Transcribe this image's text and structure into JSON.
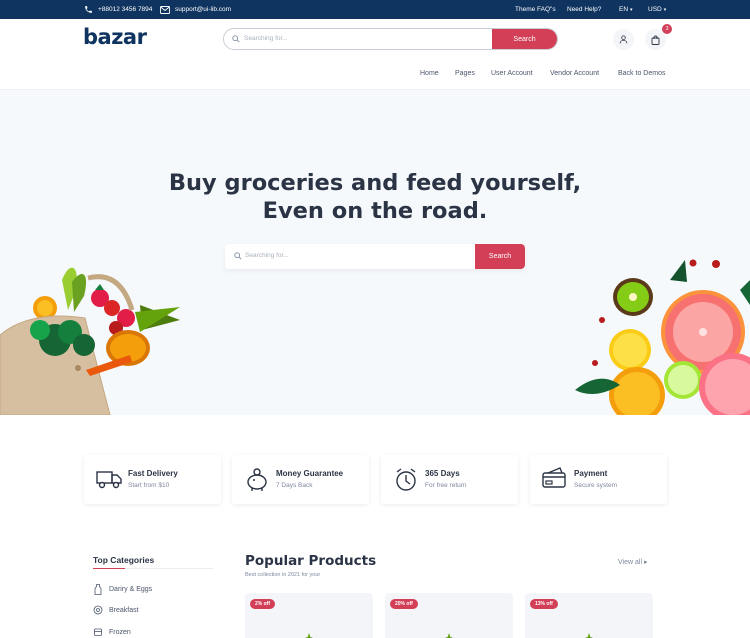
{
  "topbar": {
    "phone": "+88012 3456 7894",
    "email": "support@ui-lib.com",
    "faq": "Theme FAQ\"s",
    "help": "Need Help?",
    "language": "EN",
    "currency": "USD"
  },
  "header": {
    "logo": "bazar",
    "search_placeholder": "Searching for...",
    "search_button": "Search",
    "cart_count": "3",
    "nav": [
      "Home",
      "Pages",
      "User Account",
      "Vendor Account",
      "Back to Demos"
    ]
  },
  "hero": {
    "title_line1": "Buy groceries and feed yourself,",
    "title_line2": "Even on the road.",
    "search_placeholder": "Searching for...",
    "search_button": "Search"
  },
  "services": [
    {
      "title": "Fast Delivery",
      "subtitle": "Start from $10",
      "icon": "truck-icon"
    },
    {
      "title": "Money Guarantee",
      "subtitle": "7 Days Back",
      "icon": "piggy-bank-icon"
    },
    {
      "title": "365 Days",
      "subtitle": "For free return",
      "icon": "alarm-clock-icon"
    },
    {
      "title": "Payment",
      "subtitle": "Secure system",
      "icon": "credit-card-icon"
    }
  ],
  "categories": {
    "title": "Top Categories",
    "items": [
      {
        "label": "Dariry & Eggs",
        "icon": "milk-bottle-icon"
      },
      {
        "label": "Breakfast",
        "icon": "breakfast-icon"
      },
      {
        "label": "Frozen",
        "icon": "frozen-icon"
      }
    ]
  },
  "products": {
    "title": "Popular Products",
    "subtitle": "Best collection in 2021 for your",
    "view_all": "View all",
    "cards": [
      {
        "discount": "2% off"
      },
      {
        "discount": "20% off"
      },
      {
        "discount": "13% off"
      }
    ]
  },
  "colors": {
    "primary": "#0f3460",
    "accent": "#d23f57",
    "hero_bg": "#f6f9fc"
  }
}
